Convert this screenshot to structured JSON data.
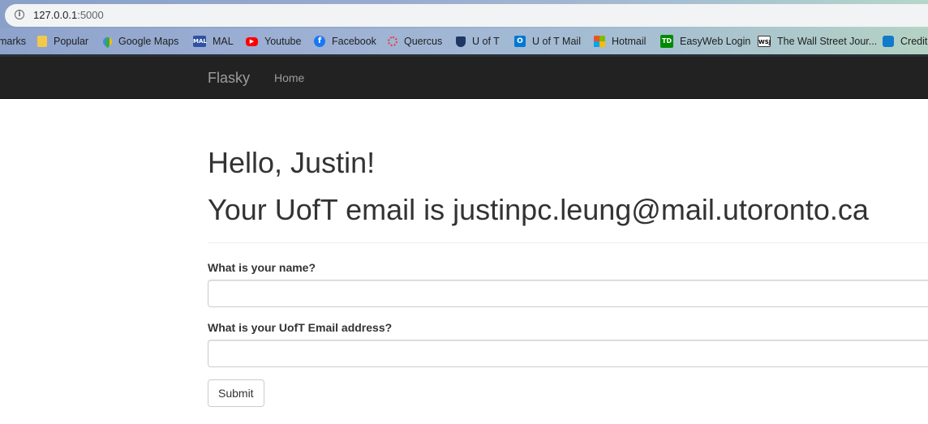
{
  "browser": {
    "url_host": "127.0.0.1",
    "url_port": ":5000",
    "bookmarks": [
      {
        "label": "marks",
        "icon": "none"
      },
      {
        "label": "Popular",
        "icon": "folder-icon",
        "color": "#f2c94c"
      },
      {
        "label": "Google Maps",
        "icon": "google-maps-icon",
        "color": "#34a853"
      },
      {
        "label": "MAL",
        "icon": "mal-icon",
        "color": "#2e51a2"
      },
      {
        "label": "Youtube",
        "icon": "youtube-icon",
        "color": "#ff0000"
      },
      {
        "label": "Facebook",
        "icon": "facebook-icon",
        "color": "#1877f2"
      },
      {
        "label": "Quercus",
        "icon": "quercus-icon",
        "color": "#e53935"
      },
      {
        "label": "U of T",
        "icon": "uoft-icon",
        "color": "#1e3765"
      },
      {
        "label": "U of T Mail",
        "icon": "outlook-icon",
        "color": "#0078d4"
      },
      {
        "label": "Hotmail",
        "icon": "microsoft-icon",
        "color": "#f25022"
      },
      {
        "label": "EasyWeb Login",
        "icon": "td-icon",
        "color": "#008a00"
      },
      {
        "label": "The Wall Street Jour...",
        "icon": "wsj-icon",
        "color": "#ffffff"
      },
      {
        "label": "Credit",
        "icon": "chase-icon",
        "color": "#117aca"
      }
    ]
  },
  "navbar": {
    "brand": "Flasky",
    "home": "Home"
  },
  "main": {
    "greeting": "Hello, Justin!",
    "email_line": "Your UofT email is justinpc.leung@mail.utoronto.ca"
  },
  "form": {
    "name_label": "What is your name?",
    "name_value": "",
    "email_label": "What is your UofT Email address?",
    "email_value": "",
    "submit_label": "Submit"
  }
}
